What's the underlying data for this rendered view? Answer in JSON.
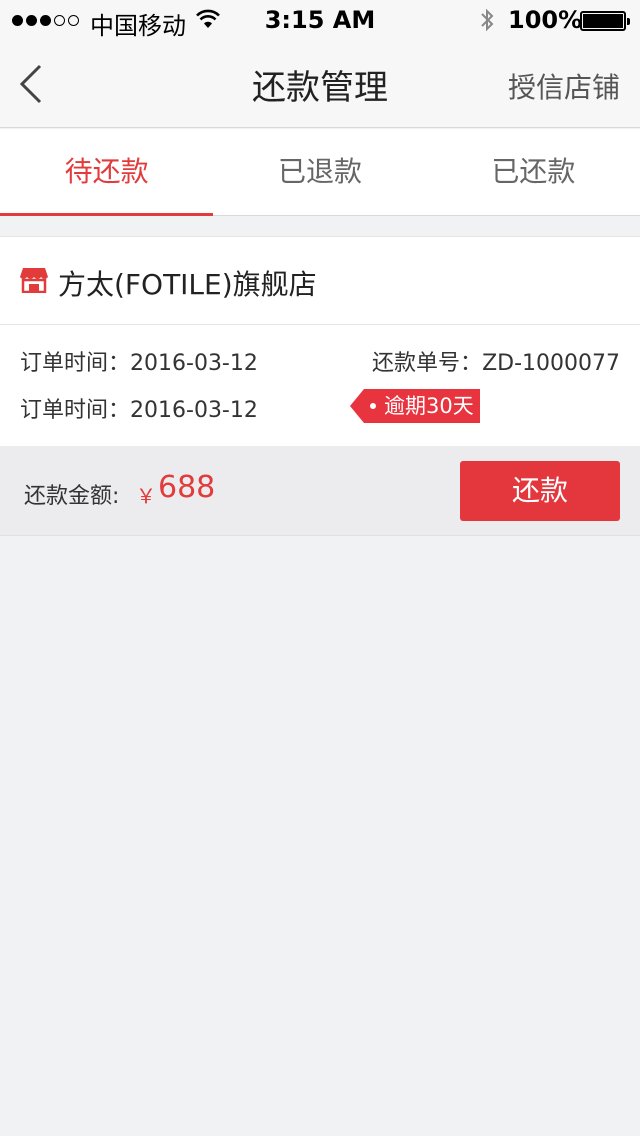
{
  "status_bar": {
    "carrier": "中国移动",
    "time": "3:15 AM",
    "battery": "100%"
  },
  "nav": {
    "title": "还款管理",
    "right_link": "授信店铺"
  },
  "tabs": [
    {
      "label": "待还款",
      "active": true
    },
    {
      "label": "已退款",
      "active": false
    },
    {
      "label": "已还款",
      "active": false
    }
  ],
  "order": {
    "shop_name": "方太(FOTILE)旗舰店",
    "order_time_label_1": "订单时间：",
    "order_time_1": "2016-03-12",
    "order_time_label_2": "订单时间：",
    "order_time_2": "2016-03-12",
    "repay_no_label": "还款单号：",
    "repay_no": "ZD-1000077",
    "overdue_badge": "逾期30天",
    "amount_label": "还款金额:",
    "currency": "￥",
    "amount": "688",
    "pay_button": "还款"
  },
  "colors": {
    "accent": "#e23b3b",
    "button": "#e3373d",
    "background": "#f1f2f4"
  }
}
